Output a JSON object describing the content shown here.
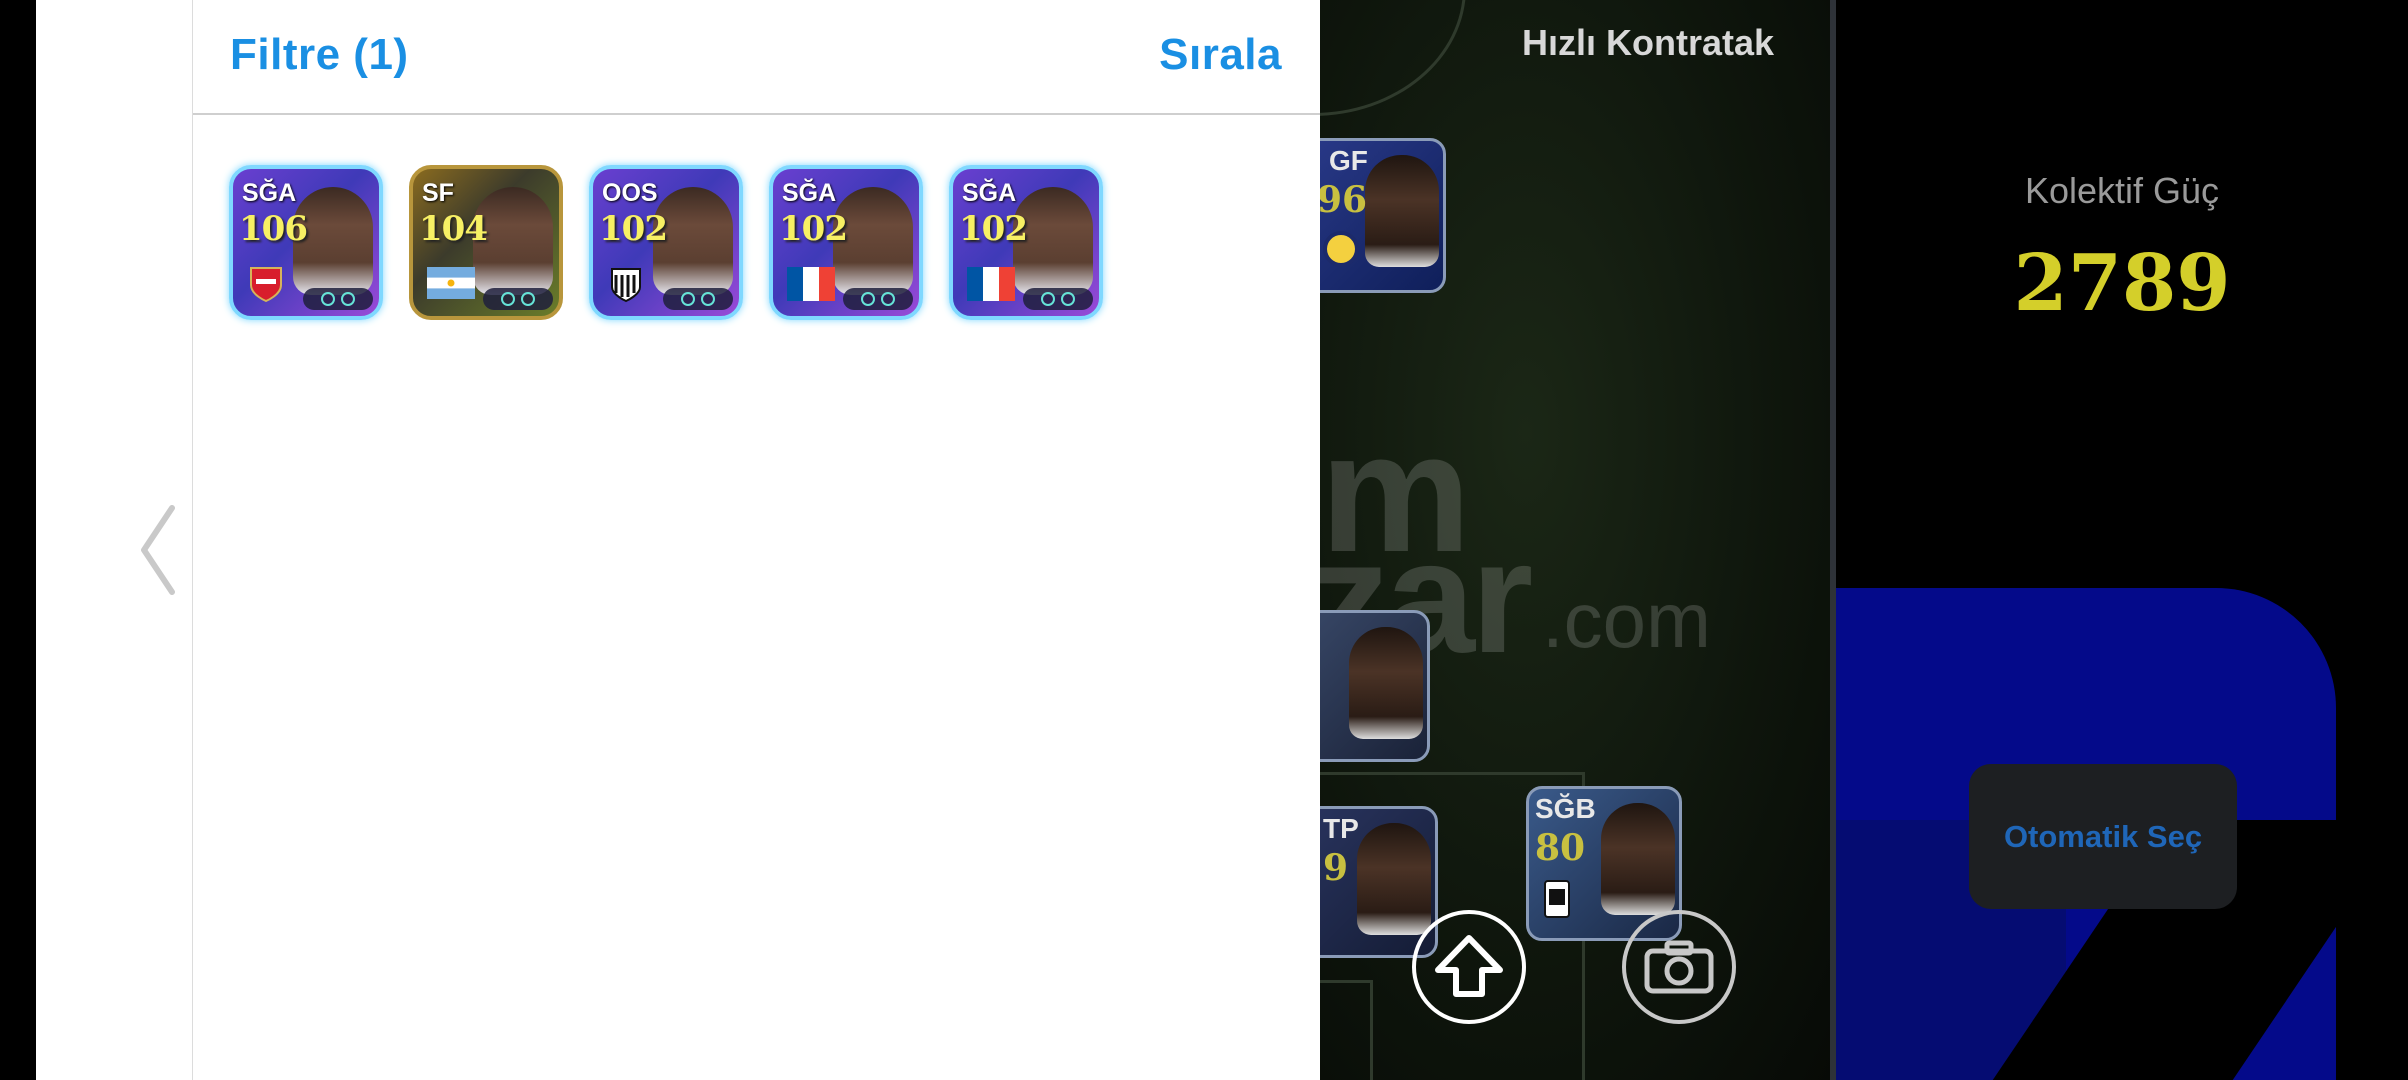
{
  "drawer": {
    "filter_label": "Filtre (1)",
    "sort_label": "Sırala",
    "back_icon": "chevron-left-icon"
  },
  "player_cards": [
    {
      "position": "SĞA",
      "rating": "106",
      "style": "purple",
      "emblem": "arsenal-crest"
    },
    {
      "position": "SF",
      "rating": "104",
      "style": "gold",
      "emblem": "argentina-flag"
    },
    {
      "position": "OOS",
      "rating": "102",
      "style": "purple",
      "emblem": "santos-crest"
    },
    {
      "position": "SĞA",
      "rating": "102",
      "style": "purple",
      "emblem": "france-flag"
    },
    {
      "position": "SĞA",
      "rating": "102",
      "style": "purple",
      "emblem": "france-flag"
    }
  ],
  "pitch": {
    "tactic_label": "Hızlı Kontratak",
    "watermark": [
      "m",
      "zar",
      ".com"
    ],
    "cards": [
      {
        "position": "GF",
        "rating": "96",
        "emblem": "fenerbahce-crest"
      },
      {
        "position": "",
        "rating": "",
        "emblem": "red-crest"
      },
      {
        "position": "TP",
        "rating": "9",
        "emblem": "besiktas-crest"
      },
      {
        "position": "SĞB",
        "rating": "80",
        "emblem": "besiktas-crest"
      }
    ],
    "buttons": {
      "up": "arrow-up-icon",
      "camera": "camera-icon"
    }
  },
  "side": {
    "power_label": "Kolektif Güç",
    "power_value": "2789",
    "auto_select_label": "Otomatik Seç"
  },
  "colors": {
    "accent_blue": "#1a8fe3",
    "rating_yellow": "#f7f064",
    "power_yellow": "#d4cf2a"
  }
}
